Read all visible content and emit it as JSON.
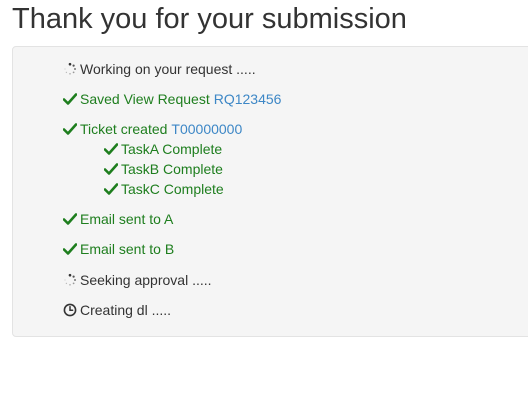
{
  "page": {
    "title": "Thank you for your submission"
  },
  "colors": {
    "success": "#1e7e1e",
    "link": "#3d87c6",
    "text": "#333333",
    "panel_bg": "#f5f5f5"
  },
  "status": {
    "working": {
      "icon": "spinner-icon",
      "text": "Working on your request ....."
    },
    "view_request": {
      "icon": "check-icon",
      "text": "Saved View Request",
      "link": "RQ123456"
    },
    "ticket": {
      "icon": "check-icon",
      "text": "Ticket created",
      "link": "T00000000"
    },
    "tasks": [
      {
        "icon": "check-icon",
        "text": "TaskA Complete"
      },
      {
        "icon": "check-icon",
        "text": "TaskB Complete"
      },
      {
        "icon": "check-icon",
        "text": "TaskC Complete"
      }
    ],
    "email_a": {
      "icon": "check-icon",
      "text": "Email sent to A"
    },
    "email_b": {
      "icon": "check-icon",
      "text": "Email sent to B"
    },
    "approval": {
      "icon": "spinner-icon",
      "text": "Seeking approval ....."
    },
    "creating": {
      "icon": "clock-icon",
      "text": "Creating dl ....."
    }
  }
}
